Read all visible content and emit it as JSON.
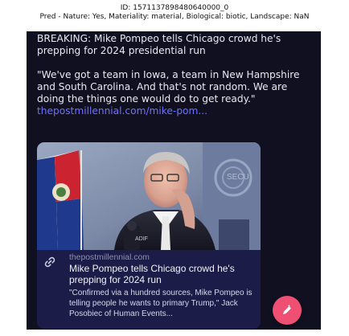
{
  "header": {
    "id_line": "ID: 1571137898480640000_0",
    "pred_line": "Pred - Nature: Yes, Materiality: material, Biological: biotic, Landscape: NaN"
  },
  "tweet": {
    "headline": "BREAKING: Mike Pompeo tells Chicago crowd he's prepping for 2024 presidential run",
    "quote": "\"We've got a team in Iowa, a team in New Hampshire and South Carolina. And that's not random. We are doing the things one would do to get ready.\"",
    "link": "thepostmillennial.com/mike-pom..."
  },
  "card": {
    "domain": "thepostmillennial.com",
    "title": "Mike Pompeo tells Chicago crowd he's prepping for 2024 run",
    "description": "\"Confirmed via a hundred sources, Mike Pompeo is telling people he wants to primary Trump,\" Jack Posobiec of Human Events..."
  },
  "icons": {
    "card_link": "link-icon",
    "compose": "compose-icon"
  },
  "colors": {
    "background": "#101021",
    "card_background": "#1b1c48",
    "link": "#6f70ff",
    "fab": "#ef4f72"
  }
}
